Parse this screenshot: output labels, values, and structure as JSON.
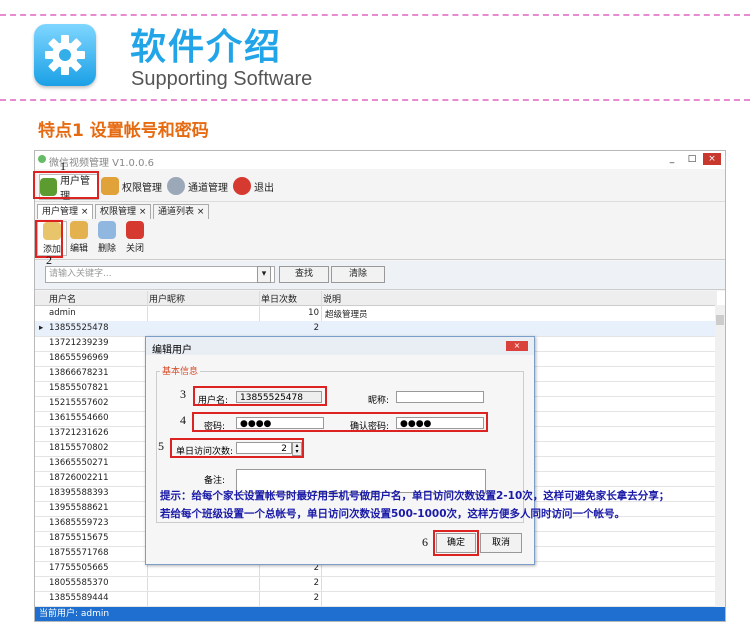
{
  "header": {
    "title_cn": "软件介绍",
    "title_en": "Supporting Software",
    "feature": "特点1 设置帐号和密码"
  },
  "window": {
    "title": "微信视频管理 V1.0.0.6",
    "controls": [
      "_",
      "□",
      "×"
    ],
    "toolbar": [
      {
        "label": "用户管理",
        "icon": "users-icon"
      },
      {
        "label": "权限管理",
        "icon": "permission-icon"
      },
      {
        "label": "通道管理",
        "icon": "gear-icon"
      },
      {
        "label": "退出",
        "icon": "exit-icon"
      }
    ],
    "tabs": [
      "用户管理 ×",
      "权限管理 ×",
      "通道列表 ×"
    ],
    "subtoolbar": [
      {
        "label": "添加",
        "icon": "add-icon"
      },
      {
        "label": "编辑",
        "icon": "edit-icon"
      },
      {
        "label": "删除",
        "icon": "delete-icon"
      },
      {
        "label": "关闭",
        "icon": "close-icon"
      }
    ],
    "search_placeholder": "请输入关键字...",
    "search_button": "查找",
    "clear_button": "清除",
    "columns": [
      "用户名",
      "用户昵称",
      "单日次数",
      "说明"
    ],
    "rows": [
      {
        "user": "admin",
        "count": "10",
        "desc": "超级管理员"
      },
      {
        "user": "13855525478",
        "count": "2",
        "desc": ""
      },
      {
        "user": "13721239239",
        "count": "",
        "desc": ""
      },
      {
        "user": "18655596969",
        "count": "",
        "desc": ""
      },
      {
        "user": "13866678231",
        "count": "",
        "desc": ""
      },
      {
        "user": "15855507821",
        "count": "",
        "desc": ""
      },
      {
        "user": "15215557602",
        "count": "",
        "desc": ""
      },
      {
        "user": "13615554660",
        "count": "",
        "desc": ""
      },
      {
        "user": "13721231626",
        "count": "",
        "desc": ""
      },
      {
        "user": "18155570802",
        "count": "",
        "desc": ""
      },
      {
        "user": "13665550271",
        "count": "",
        "desc": ""
      },
      {
        "user": "18726002211",
        "count": "",
        "desc": ""
      },
      {
        "user": "18395588393",
        "count": "",
        "desc": ""
      },
      {
        "user": "13955588621",
        "count": "",
        "desc": ""
      },
      {
        "user": "13685559723",
        "count": "",
        "desc": ""
      },
      {
        "user": "18755515675",
        "count": "",
        "desc": ""
      },
      {
        "user": "18755571768",
        "count": "",
        "desc": ""
      },
      {
        "user": "17755505665",
        "count": "2",
        "desc": ""
      },
      {
        "user": "18055585370",
        "count": "2",
        "desc": ""
      },
      {
        "user": "13855589444",
        "count": "2",
        "desc": ""
      }
    ],
    "status": "当前用户: admin"
  },
  "dialog": {
    "title": "编辑用户",
    "close": "×",
    "group": "基本信息",
    "username_label": "用户名:",
    "username_value": "13855525478",
    "nickname_label": "昵称:",
    "password_label": "密码:",
    "password_value": "●●●●",
    "confirm_label": "确认密码:",
    "confirm_value": "●●●●",
    "daily_label": "单日访问次数:",
    "daily_value": "2",
    "remark_label": "备注:",
    "ok_button": "确定",
    "cancel_button": "取消"
  },
  "markers": [
    "1",
    "2",
    "3",
    "4",
    "5",
    "6"
  ],
  "notes": [
    "提示：给每个家长设置帐号时最好用手机号做用户名，单日访问次数设置2-10次，这样可避免家长拿去分享；",
    "若给每个班级设置一个总帐号，单日访问次数设置500-1000次，这样方便多人同时访问一个帐号。"
  ]
}
